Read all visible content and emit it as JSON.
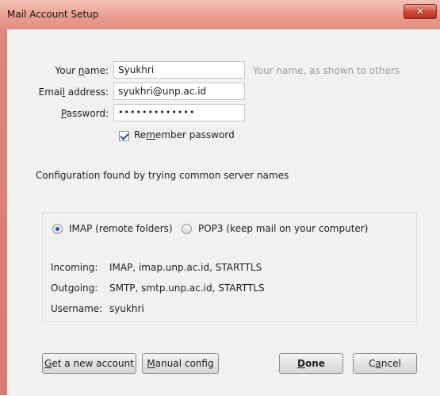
{
  "window": {
    "title": "Mail Account Setup"
  },
  "form": {
    "name_label": {
      "pre": "Your ",
      "u": "n",
      "post": "ame:"
    },
    "name_value": "Syukhri",
    "name_hint": "Your name, as shown to others",
    "email_label": {
      "pre": "Emai",
      "u": "l",
      "post": " address:"
    },
    "email_value": "syukhri@unp.ac.id",
    "password_label": {
      "pre": "",
      "u": "P",
      "post": "assword:"
    },
    "password_value": "•••••••••••••",
    "remember": {
      "pre": "Re",
      "u": "m",
      "post": "ember password",
      "checked": true
    }
  },
  "status_text": "Configuration found by trying common server names",
  "protocol": {
    "imap_label": "IMAP (remote folders)",
    "pop3_label": "POP3 (keep mail on your computer)",
    "selected": "imap"
  },
  "server_info": {
    "incoming_label": "Incoming:",
    "incoming_value": "IMAP, imap.unp.ac.id, STARTTLS",
    "outgoing_label": "Outgoing:",
    "outgoing_value": "SMTP, smtp.unp.ac.id, STARTTLS",
    "username_label": "Username:",
    "username_value": "syukhri"
  },
  "buttons": {
    "new_account": {
      "u": "G",
      "post": "et a new account"
    },
    "manual_config": {
      "u": "M",
      "post": "anual config"
    },
    "done": {
      "u": "D",
      "post": "one"
    },
    "cancel": {
      "pre": "C",
      "u": "a",
      "post": "ncel"
    }
  }
}
